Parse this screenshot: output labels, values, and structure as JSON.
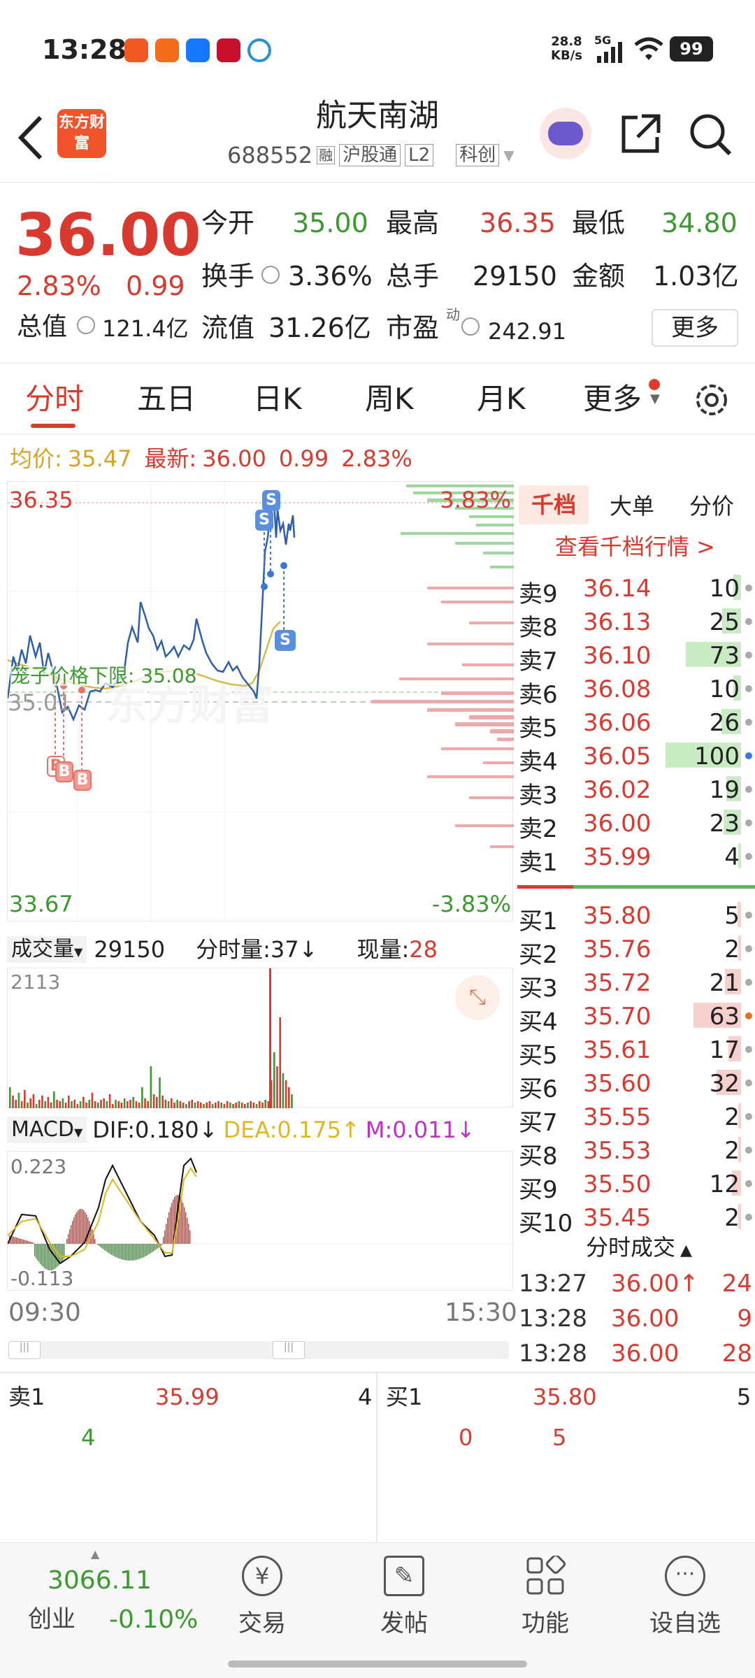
{
  "status_bar": {
    "time": "13:28",
    "net_speed": "28.8",
    "net_unit": "KB/s",
    "signal": "5G",
    "battery": "99"
  },
  "header": {
    "title": "航天南湖",
    "code": "688552",
    "tags": [
      "融",
      "沪股通",
      "L2",
      "科创"
    ],
    "logo_text": "东方财富"
  },
  "quote": {
    "price": "36.00",
    "change_pct": "2.83%",
    "change": "0.99",
    "open_label": "今开",
    "open": "35.00",
    "high_label": "最高",
    "high": "36.35",
    "low_label": "最低",
    "low": "34.80",
    "turnover_label": "换手",
    "turnover": "3.36%",
    "volume_label": "总手",
    "volume": "29150",
    "amount_label": "金额",
    "amount": "1.03亿",
    "mktcap_label": "总值",
    "mktcap": "121.4亿",
    "float_label": "流值",
    "float_cap": "31.26亿",
    "pe_label": "市盈",
    "pe_sup": "动",
    "pe": "242.91",
    "more": "更多"
  },
  "tabs": [
    "分时",
    "五日",
    "日K",
    "周K",
    "月K",
    "更多"
  ],
  "chart_info": {
    "avg_label": "均价:",
    "avg": "35.47",
    "latest_label": "最新:",
    "latest": "36.00",
    "chg": "0.99",
    "pct": "2.83%"
  },
  "price_axis": {
    "top": "36.35",
    "top_pct": "3.83%",
    "mid": "35.01",
    "bottom": "33.67",
    "bottom_pct": "-3.83%"
  },
  "limit_line": {
    "label": "笼子价格下限:",
    "value": "35.08"
  },
  "markers": {
    "buy": "B",
    "sell": "S"
  },
  "volume_panel": {
    "label": "成交量",
    "total": "29150",
    "minute_label": "分时量:",
    "minute": "37",
    "arrow": "↓",
    "now_label": "现量:",
    "now": "28",
    "max": "2113"
  },
  "macd_panel": {
    "label": "MACD",
    "dif": "DIF:0.180",
    "dif_arrow": "↓",
    "dea": "DEA:0.175",
    "dea_arrow": "↑",
    "m": "M:0.011",
    "m_arrow": "↓",
    "max": "0.223",
    "min": "-0.113"
  },
  "time_axis": {
    "start": "09:30",
    "end": "15:30"
  },
  "orderbook": {
    "tabs": [
      "千档",
      "大单",
      "分价"
    ],
    "link": "查看千档行情 >",
    "sells": [
      {
        "label": "卖9",
        "price": "36.14",
        "vol": "10"
      },
      {
        "label": "卖8",
        "price": "36.13",
        "vol": "25"
      },
      {
        "label": "卖7",
        "price": "36.10",
        "vol": "73"
      },
      {
        "label": "卖6",
        "price": "36.08",
        "vol": "10"
      },
      {
        "label": "卖5",
        "price": "36.06",
        "vol": "26"
      },
      {
        "label": "卖4",
        "price": "36.05",
        "vol": "100"
      },
      {
        "label": "卖3",
        "price": "36.02",
        "vol": "19"
      },
      {
        "label": "卖2",
        "price": "36.00",
        "vol": "23"
      },
      {
        "label": "卖1",
        "price": "35.99",
        "vol": "4"
      }
    ],
    "buys": [
      {
        "label": "买1",
        "price": "35.80",
        "vol": "5"
      },
      {
        "label": "买2",
        "price": "35.76",
        "vol": "2"
      },
      {
        "label": "买3",
        "price": "35.72",
        "vol": "21"
      },
      {
        "label": "买4",
        "price": "35.70",
        "vol": "63"
      },
      {
        "label": "买5",
        "price": "35.61",
        "vol": "17"
      },
      {
        "label": "买6",
        "price": "35.60",
        "vol": "32"
      },
      {
        "label": "买7",
        "price": "35.55",
        "vol": "2"
      },
      {
        "label": "买8",
        "price": "35.53",
        "vol": "2"
      },
      {
        "label": "买9",
        "price": "35.50",
        "vol": "12"
      },
      {
        "label": "买10",
        "price": "35.45",
        "vol": "2"
      }
    ]
  },
  "trades": {
    "header": "分时成交",
    "rows": [
      {
        "time": "13:27",
        "price": "36.00↑",
        "vol": "24"
      },
      {
        "time": "13:28",
        "price": "36.00",
        "vol": "9"
      },
      {
        "time": "13:28",
        "price": "36.00",
        "vol": "28"
      }
    ]
  },
  "bottom_quote": {
    "sell_label": "卖1",
    "sell_price": "35.99",
    "sell_vol": "4",
    "buy_label": "买1",
    "buy_price": "35.80",
    "buy_vol": "5",
    "sell_queue": "4",
    "buy_queue_a": "0",
    "buy_queue_b": "5"
  },
  "nav": {
    "index_value": "3066.11",
    "index_name": "创业",
    "index_change": "-0.10%",
    "items": [
      {
        "label": "交易",
        "icon": "yen-trade-icon"
      },
      {
        "label": "发帖",
        "icon": "edit-post-icon"
      },
      {
        "label": "功能",
        "icon": "apps-grid-icon"
      },
      {
        "label": "设自选",
        "icon": "add-watchlist-icon"
      }
    ]
  },
  "colors": {
    "up": "#d93a2f",
    "down": "#3a9a2e",
    "line": "#2e5fa8",
    "avg": "#d8b94a"
  }
}
